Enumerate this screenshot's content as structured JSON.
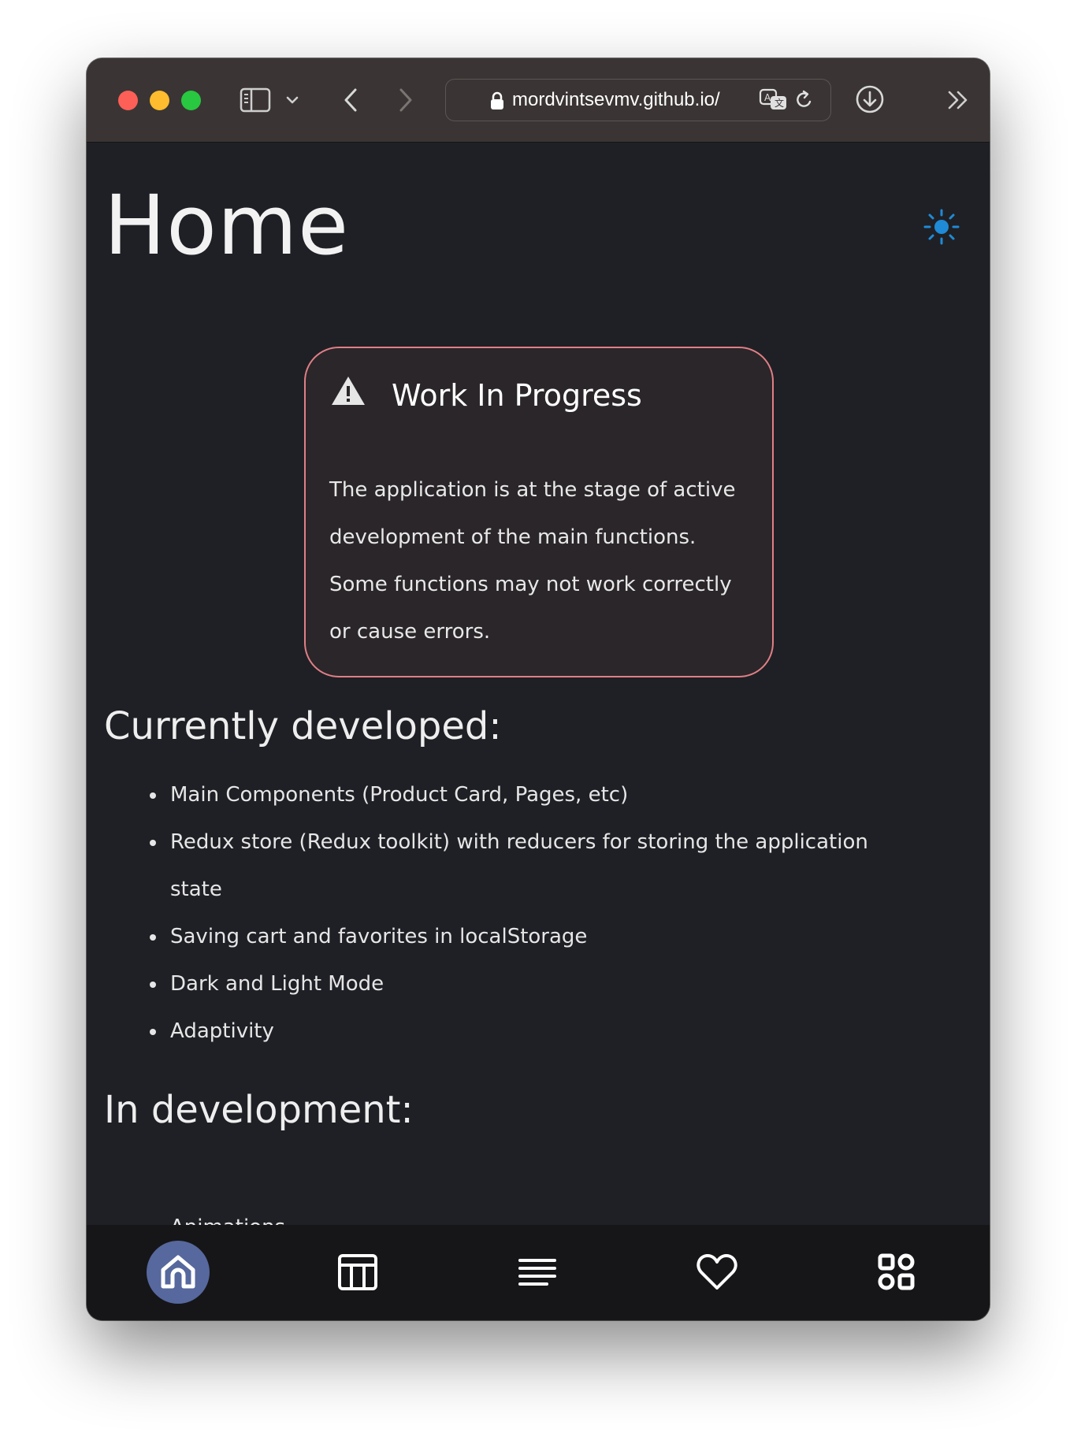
{
  "browser": {
    "url": "mordvintsevmv.github.io/",
    "icons": [
      "sidebar-icon",
      "chevron-down-icon",
      "back-icon",
      "forward-icon",
      "lock-icon",
      "translate-icon",
      "reload-icon",
      "download-icon",
      "more-icon"
    ]
  },
  "page": {
    "title": "Home",
    "theme_icon": "sun-icon",
    "accent_color": "#1f8ad6"
  },
  "wip": {
    "title": "Work In Progress",
    "body": "The application is at the stage of active development of the main functions. Some functions may not work correctly or cause errors.",
    "border_color": "#e07f86",
    "icon": "warning-icon"
  },
  "sections": {
    "developed": {
      "heading": "Currently developed:",
      "items": [
        "Main Components (Product Card, Pages, etc)",
        "Redux store (Redux toolkit) with reducers for storing the application state",
        "Saving cart and favorites in localStorage",
        "Dark and Light Mode",
        "Adaptivity"
      ]
    },
    "in_development": {
      "heading": "In development:",
      "items": [
        "Animations"
      ]
    }
  },
  "bottom_nav": {
    "items": [
      "home-icon",
      "catalog-icon",
      "list-icon",
      "heart-icon",
      "grid-icon"
    ],
    "active": "home-icon",
    "active_color": "#56689d"
  }
}
